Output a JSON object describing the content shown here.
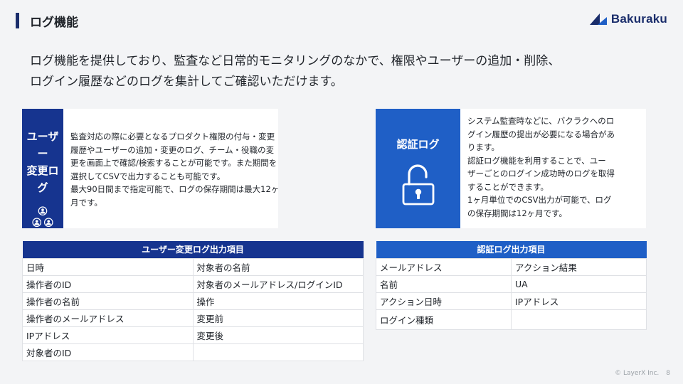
{
  "header": {
    "title": "ログ機能",
    "logo_text": "Bakuraku"
  },
  "lead": {
    "line1": "ログ機能を提供しており、監査など日常的モニタリングのなかで、権限やユーザーの追加・削除、",
    "line2": "ログイン履歴などのログを集計してご確認いただけます。"
  },
  "cards": [
    {
      "title_line1": "ユーザー",
      "title_line2": "変更ログ",
      "icon": "users-icon",
      "body": [
        "監査対応の際に必要となるプロダクト権限の付与・変更",
        "履歴やユーザーの追加・変更のログ、チーム・役職の変",
        "更を画面上で確認/検索することが可能です。また期間を",
        "選択してCSVで出力することも可能です。",
        "最大90日間まで指定可能で、ログの保存期間は最大12ヶ",
        "月です。"
      ]
    },
    {
      "title": "認証ログ",
      "icon": "lock-open-icon",
      "body": [
        "システム監査時などに、バクラクへのロ",
        "グイン履歴の提出が必要になる場合があ",
        "ります。",
        "認証ログ機能を利用することで、ユー",
        "ザーごとのログイン成功時のログを取得",
        "することができます。",
        "1ヶ月単位でのCSV出力が可能で、ログ",
        "の保存期間は12ヶ月です。"
      ]
    }
  ],
  "tables": {
    "user_log": {
      "header": "ユーザー変更ログ出力項目",
      "rows": [
        [
          "日時",
          "対象者の名前"
        ],
        [
          "操作者のID",
          "対象者のメールアドレス/ログインID"
        ],
        [
          "操作者の名前",
          "操作"
        ],
        [
          "操作者のメールアドレス",
          "変更前"
        ],
        [
          "IPアドレス",
          "変更後"
        ],
        [
          "対象者のID",
          ""
        ]
      ]
    },
    "auth_log": {
      "header": "認証ログ出力項目",
      "rows": [
        [
          "メールアドレス",
          "アクション結果"
        ],
        [
          "名前",
          "UA"
        ],
        [
          "アクション日時",
          "IPアドレス"
        ],
        [
          "ログイン種類",
          ""
        ]
      ]
    }
  },
  "footer": {
    "copyright": "© LayerX Inc.",
    "page": "8"
  },
  "colors": {
    "navy": "#16348f",
    "blue": "#1f5fc6",
    "background": "#f3f4f6"
  }
}
